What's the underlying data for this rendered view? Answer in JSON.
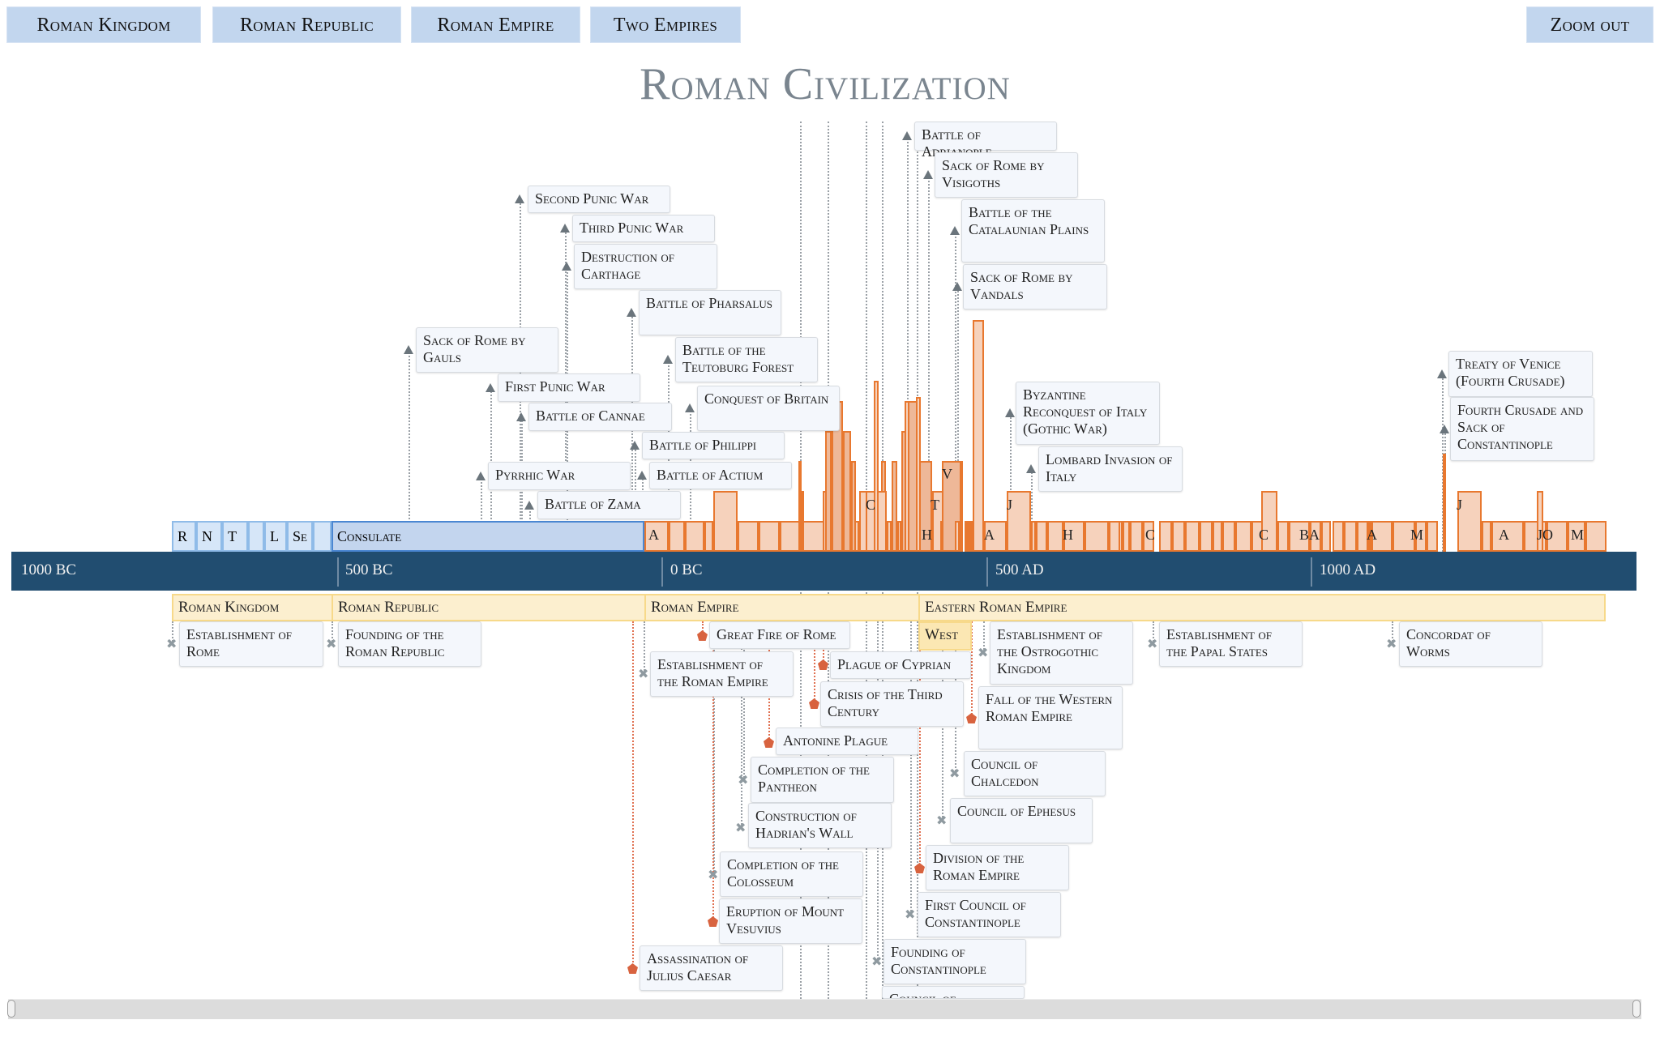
{
  "nav": {
    "buttons": [
      "Roman Kingdom",
      "Roman Republic",
      "Roman Empire",
      "Two Empires"
    ],
    "zoom_out": "Zoom out"
  },
  "title": "Roman Civilization",
  "axis": {
    "ticks": [
      "1000 BC",
      "500 BC",
      "0 BC",
      "500 AD",
      "1000 AD"
    ]
  },
  "rulers_row": {
    "kingdom_segments": [
      "R",
      "N",
      "T",
      "",
      "L",
      "Se",
      ""
    ],
    "consulate": "Consulate",
    "orange_labels": [
      "A",
      "C",
      "T",
      "V",
      "H",
      "J",
      "A",
      "H",
      "C",
      "C",
      "BA",
      "A",
      "M",
      "J",
      "A",
      "JO",
      "M"
    ]
  },
  "periods": {
    "items": [
      "Roman Kingdom",
      "Roman Republic",
      "Roman Empire",
      "Eastern Roman Empire",
      "West"
    ]
  },
  "events_above": [
    "Battle of Adrianople",
    "Sack of Rome by Visigoths",
    "Battle of the Catalaunian Plains",
    "Sack of Rome by Vandals",
    "Second Punic War",
    "Third Punic War",
    "Destruction of Carthage",
    "Battle of Pharsalus",
    "Sack of Rome by Gauls",
    "Battle of the Teutoburg Forest",
    "First Punic War",
    "Conquest of Britain",
    "Battle of Cannae",
    "Battle of Philippi",
    "Pyrrhic War",
    "Battle of Actium",
    "Battle of Zama",
    "Byzantine Reconquest of Italy (Gothic War)",
    "Lombard Invasion of Italy",
    "Treaty of Venice (Fourth Crusade)",
    "Fourth Crusade and Sack of Constantinople"
  ],
  "events_below": [
    "Establishment of Rome",
    "Founding of the Roman Republic",
    "Great Fire of Rome",
    "Establishment of the Roman Empire",
    "Plague of Cyprian",
    "Crisis of the Third Century",
    "Antonine Plague",
    "Completion of the Pantheon",
    "Construction of Hadrian's Wall",
    "Completion of the Colosseum",
    "Eruption of Mount Vesuvius",
    "Assassination of Julius Caesar",
    "Establishment of the Ostrogothic Kingdom",
    "Fall of the Western Roman Empire",
    "Council of Chalcedon",
    "Council of Ephesus",
    "Division of the Roman Empire",
    "First Council of Constantinople",
    "Founding of Constantinople",
    "Council of",
    "Establishment of the Papal States",
    "Concordat of Worms"
  ],
  "colors": {
    "nav_button": "#c2d6ee",
    "axis": "#214d70",
    "ruler_orange": "#e8782f",
    "ruler_blue": "#8fbbe8",
    "period_yellow": "#fcefcf",
    "disaster_marker": "#d8633f",
    "battle_marker": "#6b757c"
  }
}
